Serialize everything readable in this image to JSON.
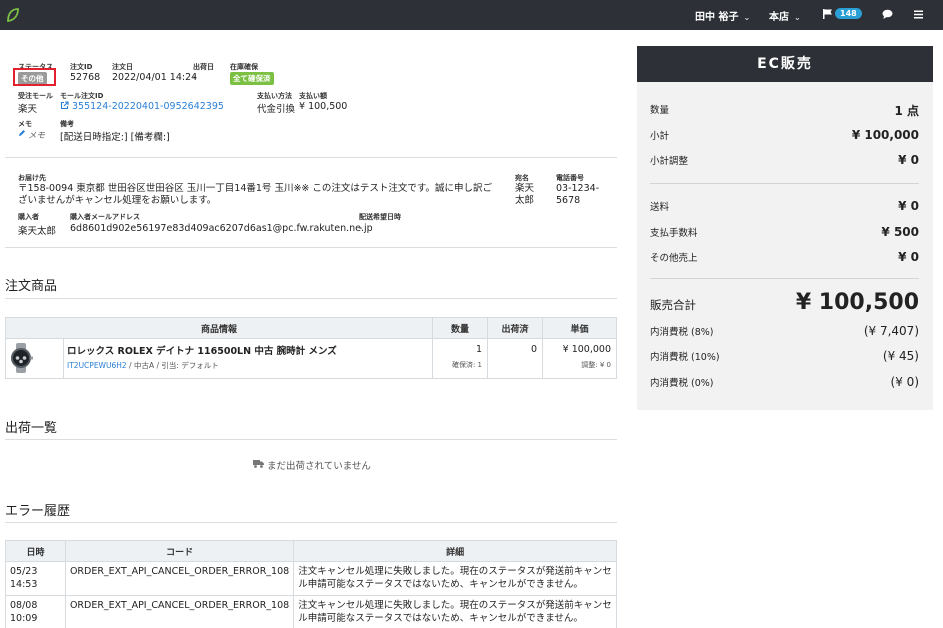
{
  "topbar": {
    "user_name": "田中 裕子",
    "store_name": "本店",
    "notification_count": "148"
  },
  "order": {
    "status_label": "ステータス",
    "status_value": "その他",
    "order_id_label": "注文ID",
    "order_id": "52768",
    "order_date_label": "注文日",
    "order_date": "2022/04/01 14:24",
    "ship_date_label": "出荷日",
    "ship_date": "-",
    "stock_label": "在庫確保",
    "stock_value": "全て確保済",
    "mall_label": "受注モール",
    "mall": "楽天",
    "mall_order_id_label": "モール注文ID",
    "mall_order_id": "355124-20220401-0952642395",
    "payment_method_label": "支払い方法",
    "payment_method": "代金引換",
    "payment_amount_label": "支払い額",
    "payment_amount": "¥ 100,500",
    "memo_label": "メモ",
    "memo_link": "メモ",
    "remarks_label": "備考",
    "remarks": "[配送日時指定:] [備考欄:]"
  },
  "shipping": {
    "address_label": "お届け先",
    "address": "〒158-0094 東京都 世田谷区世田谷区 玉川一丁目14番1号 玉川※※ この注文はテスト注文です。誠に申し訳ございませんがキャンセル処理をお願いします。",
    "recipient_label": "宛名",
    "recipient": "楽天 太郎",
    "phone_label": "電話番号",
    "phone": "03-1234-5678",
    "buyer_label": "購入者",
    "buyer": "楽天太郎",
    "buyer_email_label": "購入者メールアドレス",
    "buyer_email": "6d8601d902e56197e83d409ac6207d6as1@pc.fw.rakuten.ne.jp",
    "desired_date_label": "配送希望日時",
    "desired_date": "-"
  },
  "items_section": {
    "title": "注文商品",
    "headers": [
      "商品情報",
      "数量",
      "出荷済",
      "単価"
    ],
    "rows": [
      {
        "name": "ロレックス ROLEX デイトナ 116500LN 中古 腕時計 メンズ",
        "sku": "IT2UCPEWU6H2",
        "sub": " / 中古A / 引当: デフォルト",
        "qty": "1",
        "qty_note": "確保済: 1",
        "shipped": "0",
        "price": "¥ 100,000",
        "price_note": "調整: ¥ 0"
      }
    ]
  },
  "shipments_section": {
    "title": "出荷一覧",
    "empty_text": "まだ出荷されていません"
  },
  "errors_section": {
    "title": "エラー履歴",
    "headers": [
      "日時",
      "コード",
      "詳細"
    ],
    "rows": [
      {
        "date": "05/23 14:53",
        "code": "ORDER_EXT_API_CANCEL_ORDER_ERROR_108",
        "detail": "注文キャンセル処理に失敗しました。現在のステータスが発送前キャンセル申請可能なステータスではないため、キャンセルができません。"
      },
      {
        "date": "08/08 10:09",
        "code": "ORDER_EXT_API_CANCEL_ORDER_ERROR_108",
        "detail": "注文キャンセル処理に失敗しました。現在のステータスが発送前キャンセル申請可能なステータスではないため、キャンセルができません。"
      }
    ]
  },
  "summary": {
    "title": "EC販売",
    "quantity_label": "数量",
    "quantity": "1 点",
    "subtotal_label": "小計",
    "subtotal": "¥ 100,000",
    "subtotal_adj_label": "小計調整",
    "subtotal_adj": "¥ 0",
    "shipping_label": "送料",
    "shipping": "¥ 0",
    "payment_fee_label": "支払手数料",
    "payment_fee": "¥ 500",
    "other_label": "その他売上",
    "other": "¥ 0",
    "total_label": "販売合計",
    "total": "¥ 100,500",
    "tax8_label": "内消費税 (8%)",
    "tax8": "(¥ 7,407)",
    "tax10_label": "内消費税 (10%)",
    "tax10": "(¥ 45)",
    "tax0_label": "内消費税 (0%)",
    "tax0": "(¥ 0)"
  },
  "colors": {
    "topbar": "#2d3137",
    "link": "#2a7fd6",
    "stock_badge": "#7bc043",
    "status_badge": "#9a9a9a",
    "highlight": "#e3202d"
  }
}
